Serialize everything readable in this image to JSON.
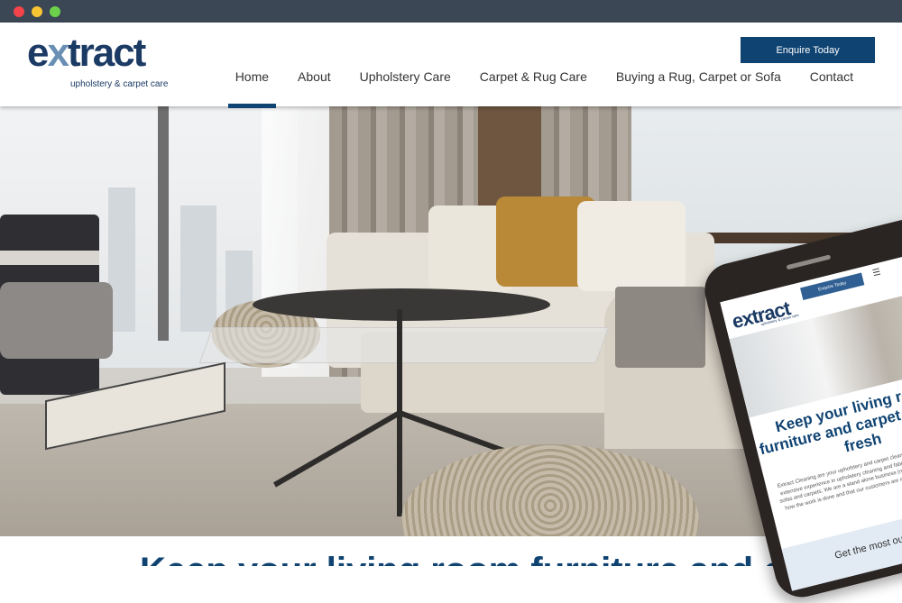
{
  "window": {
    "controls": [
      "close",
      "minimize",
      "maximize"
    ]
  },
  "header": {
    "logo": {
      "word_prefix": "e",
      "word_x": "x",
      "word_suffix": "tract",
      "tagline": "upholstery & carpet care"
    },
    "enquire_label": "Enquire Today",
    "nav": [
      {
        "label": "Home",
        "active": true
      },
      {
        "label": "About",
        "active": false
      },
      {
        "label": "Upholstery Care",
        "active": false
      },
      {
        "label": "Carpet & Rug Care",
        "active": false
      },
      {
        "label": "Buying a Rug, Carpet or Sofa",
        "active": false
      },
      {
        "label": "Contact",
        "active": false
      }
    ]
  },
  "mobile_preview": {
    "logo": "extract",
    "logo_tagline": "upholstery & carpet care",
    "enquire_label": "Enquire Today",
    "menu_icon": "hamburger-icon",
    "title": "Keep your living room furniture and carpet looking fresh",
    "body": "Extract Cleaning are your upholstery and carpet cleaning specialists. We have extensive experience in upholstery cleaning and fabric protection of your new sofas and carpets. We are a stand alone business (not a franchise), so we care how the work is done and that our customers are impressed with the results.",
    "band_text": "Get the most out of our fi"
  },
  "below_fold": {
    "heading": "Keep your living room furniture and carpet"
  },
  "colors": {
    "brand": "#0f4372",
    "titlebar": "#3b4754"
  }
}
